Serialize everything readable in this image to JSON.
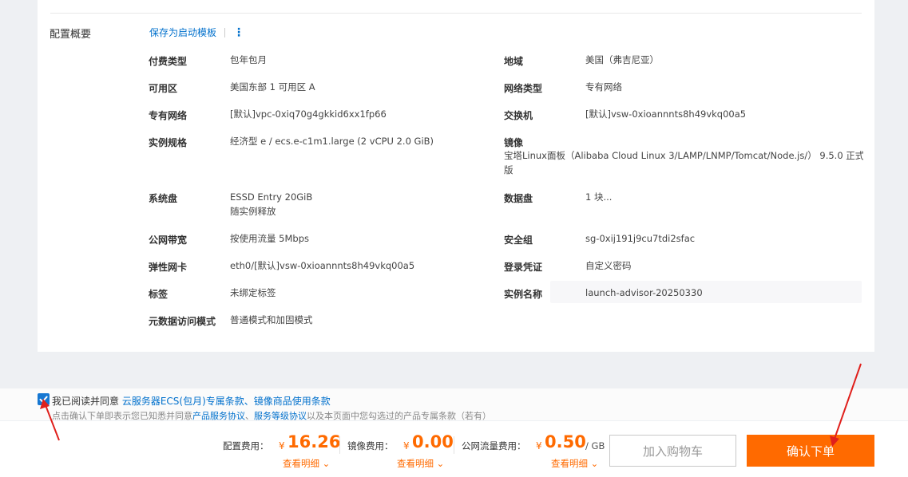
{
  "summary": {
    "title": "配置概要",
    "save_template": "保存为启动模板",
    "more": "⋮"
  },
  "left_items": [
    {
      "label": "付费类型",
      "value": "包年包月",
      "value2": ""
    },
    {
      "label": "可用区",
      "value": "美国东部 1 可用区 A",
      "value2": ""
    },
    {
      "label": "专有网络",
      "value": "[默认]vpc-0xiq70g4gkkid6xx1fp66",
      "value2": ""
    },
    {
      "label": "实例规格",
      "value": "经济型 e / ecs.e-c1m1.large (2 vCPU 2.0 GiB)",
      "value2": ""
    },
    {
      "label": "系统盘",
      "value": "ESSD Entry 20GiB",
      "value2": "随实例释放"
    },
    {
      "label": "公网带宽",
      "value": "按使用流量 5Mbps",
      "value2": ""
    },
    {
      "label": "弹性网卡",
      "value": "eth0/[默认]vsw-0xioannnts8h49vkq00a5",
      "value2": ""
    },
    {
      "label": "标签",
      "value": "未绑定标签",
      "value2": ""
    },
    {
      "label": "元数据访问模式",
      "value": "普通模式和加固模式",
      "value2": ""
    }
  ],
  "right_items": [
    {
      "label": "地域",
      "value": "美国（弗吉尼亚）",
      "value2": ""
    },
    {
      "label": "网络类型",
      "value": "专有网络",
      "value2": ""
    },
    {
      "label": "交换机",
      "value": "[默认]vsw-0xioannnts8h49vkq00a5",
      "value2": ""
    },
    {
      "label": "镜像",
      "value": "宝塔Linux面板（Alibaba Cloud Linux 3/LAMP/LNMP/Tomcat/Node.js/） 9.5.0 正式",
      "value2": "版"
    },
    {
      "label": "数据盘",
      "value": "1 块...",
      "value2": ""
    },
    {
      "label": "安全组",
      "value": "sg-0xij191j9cu7tdi2sfac",
      "value2": ""
    },
    {
      "label": "登录凭证",
      "value": "自定义密码",
      "value2": ""
    },
    {
      "label": "实例名称",
      "value": "launch-advisor-20250330",
      "value2": ""
    }
  ],
  "agreement": {
    "checked": true,
    "prefix": "我已阅读并同意 ",
    "link1": "云服务器ECS(包月)专属条款",
    "sep": "、",
    "link2": "镜像商品使用条款",
    "notice_prefix": "点击确认下单即表示您已知悉并同意",
    "notice_link1": "产品服务协议",
    "notice_sep": "、",
    "notice_link2": "服务等级协议",
    "notice_suffix": "以及本页面中您勾选过的产品专属条款（若有）"
  },
  "fees": [
    {
      "label": "配置费用：",
      "symbol": "¥",
      "amount": "16.26",
      "unit": "",
      "detail": "查看明细 ⌄"
    },
    {
      "label": "镜像费用：",
      "symbol": "¥",
      "amount": "0.00",
      "unit": "",
      "detail": "查看明细 ⌄"
    },
    {
      "label": "公网流量费用：",
      "symbol": "¥",
      "amount": "0.50",
      "unit": "/ GB",
      "detail": "查看明细 ⌄"
    }
  ],
  "buttons": {
    "add_cart": "加入购物车",
    "confirm": "确认下单"
  },
  "colors": {
    "accent": "#ff6a00",
    "link": "#0070cc",
    "checkbox": "#1677d2",
    "annotation": "#e0201c"
  },
  "icons": [
    "check-icon",
    "kebab-icon",
    "chevron-down-icon",
    "arrow-annotation-icon"
  ]
}
